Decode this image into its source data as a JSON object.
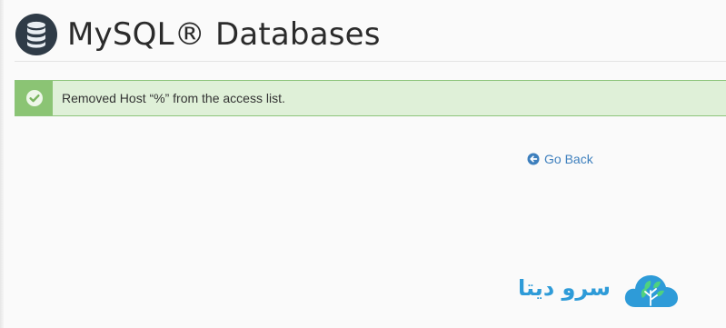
{
  "header": {
    "title": "MySQL® Databases",
    "icon": "database-icon"
  },
  "alert": {
    "type": "success",
    "icon": "check-circle-icon",
    "message": "Removed Host “%” from the access list."
  },
  "actions": {
    "go_back_label": "Go Back",
    "go_back_icon": "arrow-left-circle-icon"
  },
  "brand": {
    "name": "سرو دیتا",
    "logo": "cloud-tree-logo"
  },
  "colors": {
    "success_border": "#8cc47a",
    "success_background": "#dff0d8",
    "success_icon_background": "#8bc474",
    "link": "#3d7fbd",
    "brand": "#2e9bd8",
    "icon_dark": "#2f3b47"
  }
}
